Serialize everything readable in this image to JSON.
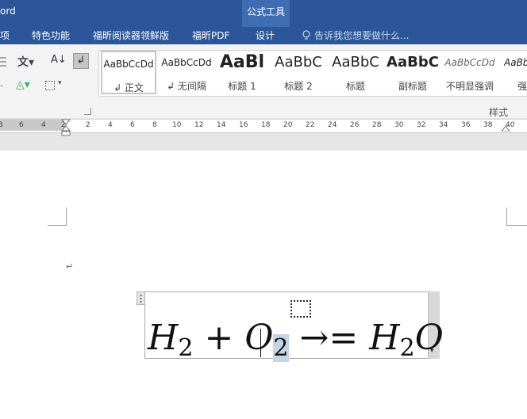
{
  "window": {
    "app_name_partial": "ord",
    "contextual_group": "公式工具"
  },
  "tabs": [
    {
      "label": "项"
    },
    {
      "label": "特色功能"
    },
    {
      "label": "福昕阅读器领鲜版"
    },
    {
      "label": "福昕PDF"
    },
    {
      "label": "设计"
    }
  ],
  "tell_me": {
    "placeholder": "告诉我您想要做什么..."
  },
  "styles": {
    "group_label": "样式",
    "items": [
      {
        "sample": "AaBbCcDd",
        "name": "↲ 正文"
      },
      {
        "sample": "AaBbCcDd",
        "name": "↲ 无间隔"
      },
      {
        "sample": "AaBl",
        "name": "标题 1"
      },
      {
        "sample": "AaBbC",
        "name": "标题 2"
      },
      {
        "sample": "AaBbC",
        "name": "标题"
      },
      {
        "sample": "AaBbC",
        "name": "副标题"
      },
      {
        "sample": "AaBbCcDd",
        "name": "不明显强调"
      },
      {
        "sample": "AaBb",
        "name": "强"
      }
    ]
  },
  "ruler": {
    "labels": [
      "8",
      "6",
      "4",
      "2",
      "2",
      "4",
      "6",
      "8",
      "10",
      "12",
      "14",
      "16",
      "18",
      "20",
      "22",
      "24",
      "26",
      "28",
      "30",
      "32",
      "34",
      "36",
      "38",
      "40"
    ]
  },
  "document": {
    "paragraph_mark": "↵",
    "equation": {
      "h": "H",
      "plus": "+",
      "o": "O",
      "sub2": "2",
      "arrow_eq": "→=",
      "o_end": "O"
    }
  },
  "icons": [
    "sort-icon",
    "text-effect-icon",
    "show-marks-icon",
    "shading-icon",
    "borders-icon",
    "lightbulb-icon",
    "paragraph-mark-icon"
  ]
}
